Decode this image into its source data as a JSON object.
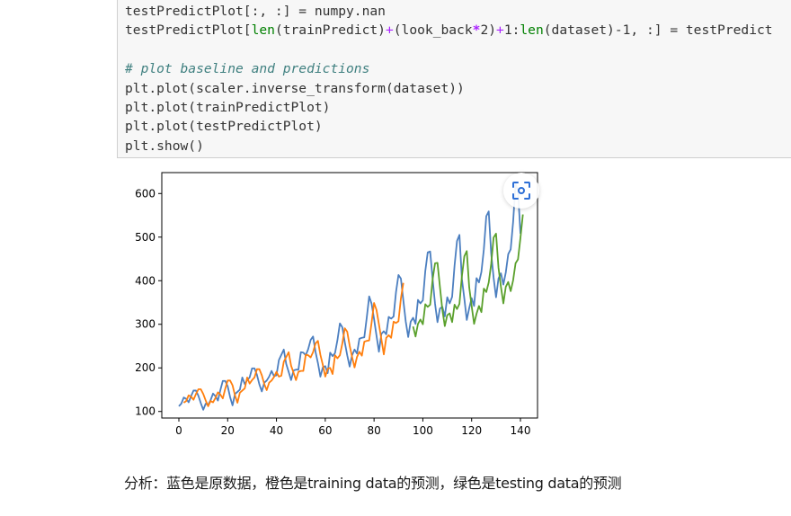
{
  "code": {
    "line1_a": "testPredictPlot[:, :] = numpy.nan",
    "line2_a": "testPredictPlot[",
    "line2_b": "len",
    "line2_c": "(trainPredict)",
    "line2_d": "+",
    "line2_e": "(look_back",
    "line2_f": "*",
    "line2_g": "2)",
    "line2_h": "+",
    "line2_i": "1:",
    "line2_j": "len",
    "line2_k": "(dataset)-1, :] = testPredict",
    "comment": "# plot baseline and predictions",
    "line4": "plt.plot(scaler.inverse_transform(dataset))",
    "line5": "plt.plot(trainPredictPlot)",
    "line6": "plt.plot(testPredictPlot)",
    "line7": "plt.show()"
  },
  "expand_icon": "focus-expand-icon",
  "caption": "分析：蓝色是原数据，橙色是training data的预测，绿色是testing data的预测",
  "chart_data": {
    "type": "line",
    "xlim": [
      -7,
      147
    ],
    "ylim": [
      85,
      648
    ],
    "x_ticks": [
      0,
      20,
      40,
      60,
      80,
      100,
      120,
      140
    ],
    "y_ticks": [
      100,
      200,
      300,
      400,
      500,
      600
    ],
    "grid": false,
    "series": [
      {
        "color": "#4c7fc0",
        "x_start": 0,
        "values": [
          112,
          118,
          132,
          129,
          121,
          135,
          148,
          148,
          136,
          119,
          104,
          118,
          115,
          126,
          141,
          135,
          125,
          149,
          170,
          170,
          158,
          133,
          114,
          140,
          145,
          150,
          178,
          163,
          172,
          178,
          199,
          199,
          184,
          162,
          146,
          166,
          171,
          180,
          193,
          181,
          183,
          218,
          230,
          242,
          209,
          191,
          172,
          194,
          196,
          196,
          236,
          235,
          229,
          243,
          264,
          272,
          237,
          211,
          180,
          201,
          204,
          188,
          235,
          227,
          234,
          264,
          302,
          293,
          259,
          229,
          203,
          229,
          242,
          233,
          267,
          269,
          270,
          315,
          364,
          347,
          312,
          274,
          237,
          278,
          284,
          277,
          317,
          313,
          318,
          374,
          413,
          405,
          355,
          306,
          271,
          306,
          315,
          301,
          356,
          348,
          355,
          422,
          465,
          467,
          404,
          347,
          305,
          336,
          340,
          318,
          362,
          348,
          363,
          435,
          491,
          505,
          404,
          359,
          310,
          337,
          360,
          342,
          406,
          396,
          420,
          472,
          548,
          559,
          463,
          407,
          362,
          405,
          417,
          391,
          419,
          461,
          472,
          535,
          622,
          606,
          508
        ]
      },
      {
        "color": "#ff7f0e",
        "x_start": 2,
        "values": [
          120,
          124,
          137,
          134,
          127,
          140,
          151,
          151,
          140,
          125,
          112,
          124,
          121,
          131,
          144,
          139,
          130,
          152,
          171,
          171,
          160,
          137,
          120,
          143,
          148,
          153,
          178,
          164,
          172,
          178,
          197,
          197,
          183,
          163,
          149,
          166,
          171,
          179,
          191,
          180,
          182,
          214,
          225,
          236,
          205,
          189,
          172,
          191,
          193,
          193,
          230,
          229,
          224,
          236,
          256,
          262,
          230,
          207,
          180,
          198,
          200,
          186,
          229,
          222,
          229,
          256,
          291,
          283,
          251,
          225,
          201,
          225,
          237,
          228,
          260,
          262,
          263,
          304,
          349,
          333,
          300,
          266,
          231,
          269,
          275,
          269,
          306,
          303,
          307,
          359,
          395
        ]
      },
      {
        "color": "#5aa02c",
        "x_start": 96,
        "values": [
          295,
          272,
          301,
          311,
          300,
          346,
          340,
          345,
          403,
          440,
          441,
          386,
          333,
          296,
          321,
          325,
          305,
          345,
          335,
          347,
          410,
          456,
          468,
          385,
          342,
          301,
          324,
          342,
          328,
          382,
          374,
          396,
          438,
          499,
          508,
          430,
          386,
          348,
          386,
          397,
          376,
          401,
          440,
          449,
          498,
          552
        ]
      }
    ]
  }
}
